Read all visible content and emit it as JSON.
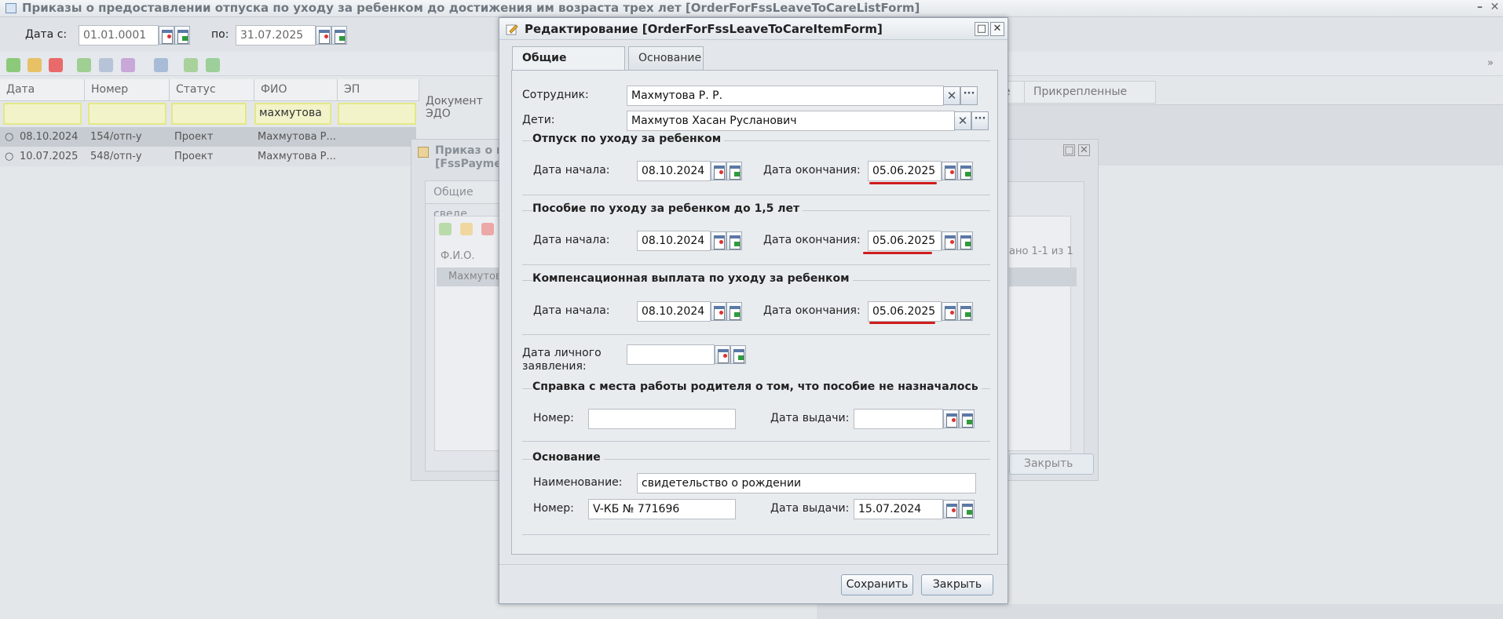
{
  "bg_window": {
    "title": "Приказы о предоставлении отпуска по уходу за ребенком до достижения им возраста трех лет [OrderForFssLeaveToCareListForm]",
    "filter": {
      "date_from_label": "Дата с:",
      "date_from_value": "01.01.0001",
      "date_to_label": "по:",
      "date_to_value": "31.07.2025"
    },
    "columns": [
      "Дата",
      "Номер",
      "Статус",
      "ФИО",
      "ЭП",
      "Документ ЭДО"
    ],
    "fio_filter_value": "махмутова",
    "rows": [
      {
        "date": "08.10.2024",
        "number": "154/отп-у",
        "status": "Проект",
        "fio": "Махмутова Р..."
      },
      {
        "date": "10.07.2025",
        "number": "548/отп-у",
        "status": "Проект",
        "fio": "Махмутова Р..."
      }
    ],
    "right_tabs": [
      "е",
      "Прикрепленные файлы"
    ]
  },
  "mid_window": {
    "title_line1": "Приказ о пр",
    "title_line2": "[FssPaymen",
    "tab": "Общие сведе",
    "col_header": "Ф.И.О.",
    "row_value": "Махмутов",
    "paging": "ано 1-1 из 1",
    "close_label": "Закрыть"
  },
  "modal": {
    "title": "Редактирование [OrderForFssLeaveToCareItemForm]",
    "tabs": [
      "Общие сведения",
      "Основание"
    ],
    "employee_label": "Сотрудник:",
    "employee_value": "Махмутова Р. Р.",
    "children_label": "Дети:",
    "children_value": "Махмутов Хасан Русланович",
    "sections": [
      {
        "title": "Отпуск по уходу за ребенком",
        "start_label": "Дата начала:",
        "start": "08.10.2024",
        "end_label": "Дата окончания:",
        "end": "05.06.2025"
      },
      {
        "title": "Пособие по уходу за ребенком до 1,5 лет",
        "start_label": "Дата начала:",
        "start": "08.10.2024",
        "end_label": "Дата окончания:",
        "end": "05.06.2025"
      },
      {
        "title": "Компенсационная выплата по уходу за ребенком",
        "start_label": "Дата начала:",
        "start": "08.10.2024",
        "end_label": "Дата окончания:",
        "end": "05.06.2025"
      }
    ],
    "personal_app_label_1": "Дата личного",
    "personal_app_label_2": "заявления:",
    "certificate": {
      "title": "Справка с места работы родителя о том, что пособие не назначалось",
      "number_label": "Номер:",
      "number_value": "",
      "issue_label": "Дата выдачи:",
      "issue_value": ""
    },
    "basis": {
      "title": "Основание",
      "name_label": "Наименование:",
      "name_value": "свидетельство о рождении",
      "number_label": "Номер:",
      "number_value": "V-КБ № 771696",
      "issue_label": "Дата выдачи:",
      "issue_value": "15.07.2024"
    },
    "save_label": "Сохранить",
    "close_label": "Закрыть"
  },
  "colors": {
    "underline": "#d01c1c",
    "filter_highlight": "#f2f3c9"
  }
}
